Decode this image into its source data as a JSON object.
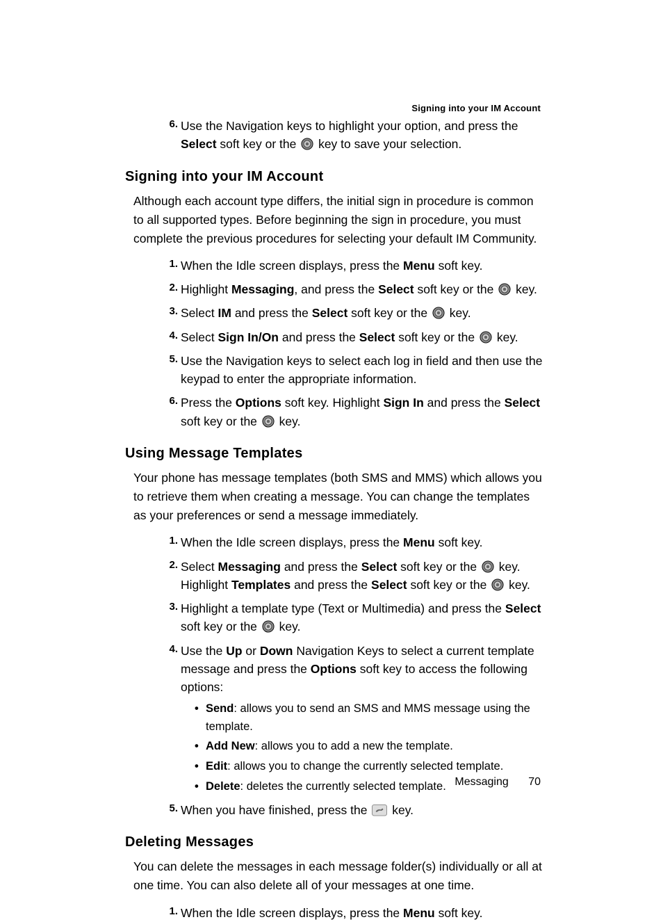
{
  "running_head": "Signing into your IM Account",
  "top_step": {
    "num": "6.",
    "p1": "Use the Navigation keys to highlight your option, and press the ",
    "b1": "Select",
    "p2": " soft key or the ",
    "p3": " key to save your selection."
  },
  "section1": {
    "title": "Signing into your IM Account",
    "intro": "Although each account type differs, the initial sign in procedure is common to all supported types. Before beginning the sign in procedure, you must complete the previous procedures for selecting your default IM Community.",
    "steps": [
      {
        "num": "1.",
        "p1": "When the Idle screen displays, press the ",
        "b1": "Menu",
        "p2": " soft key."
      },
      {
        "num": "2.",
        "p1": "Highlight ",
        "b1": "Messaging",
        "p2": ", and press the ",
        "b2": "Select",
        "p3": " soft key or the ",
        "p4": " key."
      },
      {
        "num": "3.",
        "p1": "Select ",
        "b1": "IM",
        "p2": " and press the ",
        "b2": "Select",
        "p3": " soft key or the ",
        "p4": " key."
      },
      {
        "num": "4.",
        "p1": "Select ",
        "b1": "Sign In/On",
        "p2": " and press the ",
        "b2": "Select",
        "p3": " soft key or the ",
        "p4": " key."
      },
      {
        "num": "5.",
        "p1": "Use the Navigation keys to select each log in field and then use the keypad to enter the appropriate information."
      },
      {
        "num": "6.",
        "p1": "Press the ",
        "b1": "Options",
        "p2": " soft key. Highlight ",
        "b2": "Sign In",
        "p3": " and press the ",
        "b3": "Select",
        "p4": " soft key or the ",
        "p5": " key."
      }
    ]
  },
  "section2": {
    "title": "Using Message Templates",
    "intro": "Your phone has message templates (both SMS and MMS) which allows you to retrieve them when creating a message. You can change the templates as your preferences or send a message immediately.",
    "steps": [
      {
        "num": "1.",
        "p1": "When the Idle screen displays, press the ",
        "b1": "Menu",
        "p2": " soft key."
      },
      {
        "num": "2.",
        "p1": "Select ",
        "b1": "Messaging",
        "p2": " and press the ",
        "b2": "Select",
        "p3": " soft key or the ",
        "p4": " key. Highlight ",
        "b3": "Templates",
        "p5": " and press the ",
        "b4": "Select",
        "p6": " soft key or the ",
        "p7": " key."
      },
      {
        "num": "3.",
        "p1": "Highlight a template type (Text or Multimedia) and press the ",
        "b1": "Select",
        "p2": " soft key or the ",
        "p3": " key."
      },
      {
        "num": "4.",
        "p1": "Use the ",
        "b1": "Up",
        "p2": " or ",
        "b2": "Down",
        "p3": " Navigation Keys to select a current template message and press the ",
        "b3": "Options",
        "p4": " soft key to access the following options:",
        "sub": [
          {
            "b": "Send",
            "t": ": allows you to send an SMS and MMS message using the template."
          },
          {
            "b": "Add New",
            "t": ": allows you to add a new the template."
          },
          {
            "b": "Edit",
            "t": ": allows you to change the currently selected template."
          },
          {
            "b": "Delete",
            "t": ": deletes the currently selected template."
          }
        ]
      },
      {
        "num": "5.",
        "p1": "When you have finished, press the ",
        "p2": " key."
      }
    ]
  },
  "section3": {
    "title": "Deleting Messages",
    "intro": "You can delete the messages in each message folder(s) individually or all at one time. You can also delete all of your messages at one time.",
    "steps": [
      {
        "num": "1.",
        "p1": "When the Idle screen displays, press the ",
        "b1": "Menu",
        "p2": " soft key."
      }
    ]
  },
  "footer": {
    "section": "Messaging",
    "page": "70"
  }
}
